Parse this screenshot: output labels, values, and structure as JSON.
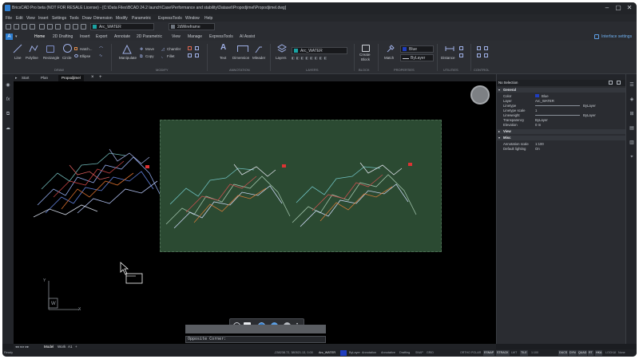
{
  "window": {
    "title": "BricsCAD Pro beta (NOT FOR RESALE License) - [C:\\Data Files\\BCAD 24.2 launch\\Case\\Performance and stability\\Dataset\\Propodjimel\\Propodjimel.dwg]",
    "app_letter": "A"
  },
  "menu": [
    "File",
    "Edit",
    "View",
    "Insert",
    "Settings",
    "Tools",
    "Draw",
    "Dimension",
    "Modify",
    "Parametric",
    "ExpressTools",
    "Window",
    "Help"
  ],
  "quick_access": {
    "layer": "Arc_WATER",
    "layer_color": "#1aa3a3",
    "visual_style": "2dWireframe"
  },
  "ribbon_tabs": [
    "Home",
    "2D Drafting",
    "Insert",
    "Export",
    "Annotate",
    "2D Parametric",
    "View",
    "Manage",
    "ExpressTools",
    "AI Assist"
  ],
  "ribbon_active_tab": "Home",
  "interface_settings": "Interface settings",
  "ribbon": {
    "draw": {
      "line": "Line",
      "polyline": "Polyline",
      "rectangle": "Rectangle",
      "circle": "Circle",
      "hatch": "Hatch...",
      "ellipse": "Ellipse",
      "group": "DRAW"
    },
    "modify": {
      "manipulate": "Manipulate",
      "move": "Move",
      "copy": "Copy",
      "chamfer": "Chamfer",
      "fillet": "Fillet",
      "group": "MODIFY"
    },
    "annotation": {
      "text": "Text",
      "dimension": "Dimension",
      "mleader": "Mleader",
      "group": "ANNOTATION"
    },
    "layers": {
      "layers": "Layers",
      "layer_name": "Arc_WATER",
      "group": "LAYERS"
    },
    "block": {
      "create": "Create",
      "block": "Block",
      "group": "BLOCK"
    },
    "properties": {
      "match": "Match",
      "color": "Blue",
      "linetype": "ByLayer",
      "group": "PROPERTIES"
    },
    "utilities": {
      "distance": "Distance",
      "group": "UTILITIES"
    },
    "control": {
      "group": "CONTROL"
    }
  },
  "doc_tabs": [
    "Start",
    "Plan",
    "Propodjimel"
  ],
  "doc_active": "Propodjimel",
  "properties_panel": {
    "selection": "No Selection",
    "general_label": "General",
    "general": [
      {
        "name": "Color",
        "value": "Blue"
      },
      {
        "name": "Layer",
        "value": "Arc_WATER"
      },
      {
        "name": "Linetype",
        "value": "ByLayer"
      },
      {
        "name": "Linetype scale",
        "value": "1"
      },
      {
        "name": "Lineweight",
        "value": "ByLayer"
      },
      {
        "name": "Transparency",
        "value": "ByLayer"
      },
      {
        "name": "Elevation",
        "value": "0 m"
      }
    ],
    "view_label": "View",
    "misc_label": "Misc",
    "misc": [
      {
        "name": "Annotation scale",
        "value": "1:100"
      },
      {
        "name": "Default lighting",
        "value": "On"
      }
    ],
    "color_swatch": "#1f3dbf"
  },
  "command": {
    "prompt": "Opposite Corner:"
  },
  "ucs": {
    "y": "Y",
    "w": "W",
    "x": "X"
  },
  "layout_tabs": [
    "Model",
    "Work",
    "A1"
  ],
  "status": {
    "ready": "Ready",
    "coords": "-238238.72, 380521.13, 0.00",
    "layer": "Arc_WATER",
    "annotation": "ByLayer",
    "annot_scale": "Annotation",
    "annotative": "Annotative",
    "drafting": "Drafting",
    "toggles": [
      "SNAP",
      "GRID",
      "ORTHO",
      "POLAR",
      "ESNAP",
      "STRACK",
      "LWT",
      "TILE",
      "1:100",
      "DUCS",
      "DYN",
      "QUAD",
      "RT",
      "HKA",
      "LOCKUI",
      "None"
    ]
  }
}
